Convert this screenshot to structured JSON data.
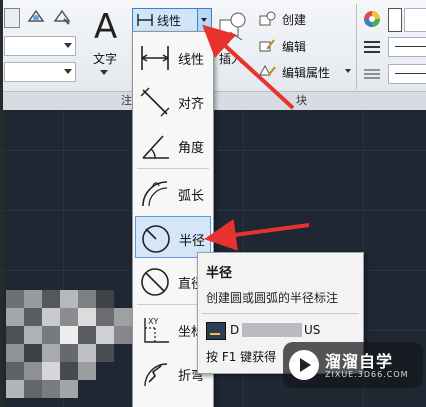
{
  "ribbon": {
    "text_label": "文字",
    "insert_label": "插入",
    "annotation_panel": "注",
    "block_panel": "块",
    "create_label": "创建",
    "edit_label": "编辑",
    "edit_attr_label": "编辑属性"
  },
  "dim_button": {
    "label": "线性"
  },
  "menu": {
    "items": [
      {
        "label": "线性",
        "icon": "linear-dimension-icon"
      },
      {
        "label": "对齐",
        "icon": "aligned-dimension-icon"
      },
      {
        "label": "角度",
        "icon": "angular-dimension-icon"
      },
      {
        "label": "弧长",
        "icon": "arc-length-icon"
      },
      {
        "label": "半径",
        "icon": "radius-dimension-icon",
        "highlighted": true
      },
      {
        "label": "直径",
        "icon": "diameter-dimension-icon"
      },
      {
        "label": "坐标",
        "icon": "ordinate-dimension-icon"
      },
      {
        "label": "折弯",
        "icon": "jogged-dimension-icon"
      }
    ]
  },
  "tooltip": {
    "title": "半径",
    "description": "创建圆或圆弧的半径标注",
    "command": "D",
    "command_suffix": "US",
    "help": "按 F1 键获得"
  },
  "watermark": {
    "name": "溜溜自学",
    "url": "ZIXUE.3D66.COM"
  },
  "colors": {
    "arrow": "#e8322d",
    "highlight": "#d4e6f8",
    "canvas": "#1f2733"
  }
}
